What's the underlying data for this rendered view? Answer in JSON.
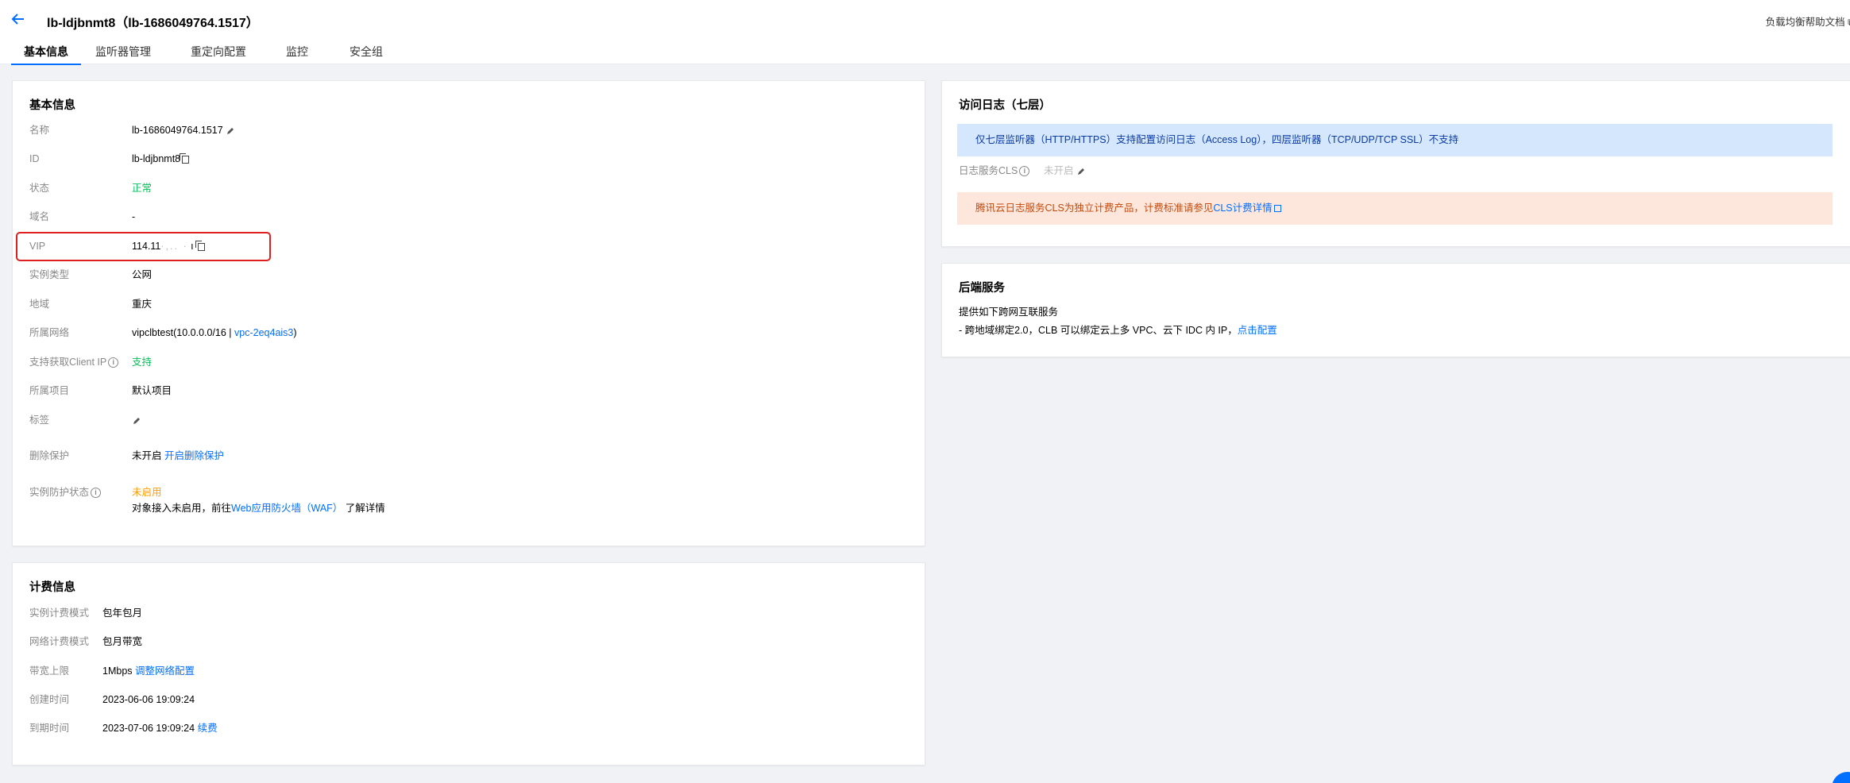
{
  "header": {
    "title": "lb-ldjbnmt8（lb-1686049764.1517）",
    "help_link": "负载均衡帮助文档",
    "tabs": [
      {
        "label": "基本信息",
        "active": true
      },
      {
        "label": "监听器管理",
        "active": false
      },
      {
        "label": "重定向配置",
        "active": false
      },
      {
        "label": "监控",
        "active": false
      },
      {
        "label": "安全组",
        "active": false
      }
    ]
  },
  "basic_info": {
    "title": "基本信息",
    "name_label": "名称",
    "name_value": "lb-1686049764.1517",
    "id_label": "ID",
    "id_value": "lb-ldjbnmt8",
    "status_label": "状态",
    "status_value": "正常",
    "domain_label": "域名",
    "domain_value": "-",
    "vip_label": "VIP",
    "vip_value": "114.11",
    "instance_type_label": "实例类型",
    "instance_type_value": "公网",
    "region_label": "地域",
    "region_value": "重庆",
    "network_label": "所属网络",
    "network_value": "vipclbtest(10.0.0.0/16 | ",
    "network_link": "vpc-2eq4ais3",
    "network_suffix": ")",
    "client_ip_label": "支持获取Client IP",
    "client_ip_value": "支持",
    "project_label": "所属项目",
    "project_value": "默认项目",
    "tags_label": "标签",
    "delete_protect_label": "删除保护",
    "delete_protect_value": "未开启",
    "delete_protect_link": "开启删除保护",
    "protect_status_label": "实例防护状态",
    "protect_status_value": "未启用",
    "protect_desc_prefix": "对象接入未启用，前往",
    "protect_desc_link": "Web应用防火墙（WAF）",
    "protect_desc_suffix": "了解详情"
  },
  "billing": {
    "title": "计费信息",
    "mode_label": "实例计费模式",
    "mode_value": "包年包月",
    "net_mode_label": "网络计费模式",
    "net_mode_value": "包月带宽",
    "bw_label": "带宽上限",
    "bw_value": "1Mbps",
    "bw_link": "调整网络配置",
    "created_label": "创建时间",
    "created_value": "2023-06-06 19:09:24",
    "expire_label": "到期时间",
    "expire_value": "2023-07-06 19:09:24",
    "expire_link": "续费"
  },
  "access_log": {
    "title": "访问日志（七层）",
    "notice": "仅七层监听器（HTTP/HTTPS）支持配置访问日志（Access Log），四层监听器（TCP/UDP/TCP SSL）不支持",
    "cls_label": "日志服务CLS",
    "cls_value": "未开启",
    "billing_notice": "腾讯云日志服务CLS为独立计费产品，计费标准请参见",
    "billing_link": "CLS计费详情"
  },
  "backend": {
    "title": "后端服务",
    "line1": "提供如下跨网互联服务",
    "line2": "- 跨地域绑定2.0，CLB 可以绑定云上多 VPC、云下 IDC 内 IP，",
    "line2_link": "点击配置"
  },
  "colors": {
    "primary": "#006eff",
    "success": "#0abf5b",
    "warning": "#ff9d00",
    "highlight": "#e02020"
  }
}
